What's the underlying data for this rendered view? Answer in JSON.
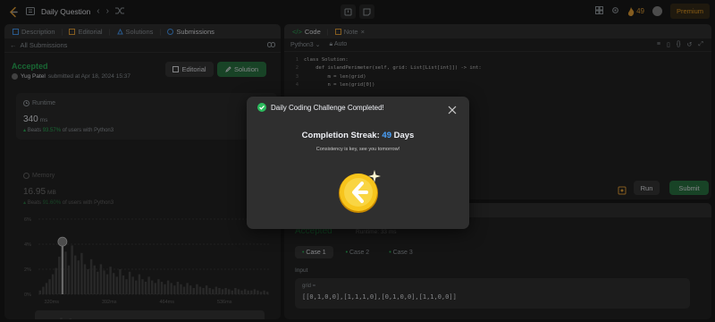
{
  "topbar": {
    "title": "Daily Question",
    "fire_count": "49",
    "premium_label": "Premium"
  },
  "left": {
    "tabs": [
      {
        "label": "Description",
        "active": false
      },
      {
        "label": "Editorial",
        "active": false
      },
      {
        "label": "Solutions",
        "active": false
      },
      {
        "label": "Submissions",
        "active": true
      }
    ],
    "back_label": "All Submissions",
    "status": "Accepted",
    "user": "Yug Patel",
    "submitted_text": "submitted at Apr 18, 2024 15:37",
    "editorial_btn": "Editorial",
    "solution_btn": "Solution",
    "runtime": {
      "label": "Runtime",
      "value": "340",
      "unit": "ms",
      "beats_prefix": "Beats",
      "beats_pct": "93.57%",
      "beats_suffix": "of users with Python3"
    },
    "memory": {
      "label": "Memory",
      "value": "16.95",
      "unit": "MB",
      "beats_prefix": "Beats",
      "beats_pct": "91.60%",
      "beats_suffix": "of users with Python3"
    }
  },
  "chart_data": {
    "type": "bar",
    "y_ticks": [
      "6%",
      "4%",
      "2%",
      "0%"
    ],
    "x_ticks": [
      "320ms",
      "392ms",
      "464ms",
      "536ms"
    ],
    "ylim": [
      0,
      6
    ],
    "values": [
      0.3,
      0.6,
      0.9,
      1.2,
      1.6,
      2.1,
      3.0,
      4.2,
      3.4,
      2.3,
      3.9,
      3.1,
      2.7,
      3.3,
      2.4,
      2.0,
      2.8,
      2.3,
      1.8,
      2.4,
      1.9,
      1.6,
      2.2,
      1.7,
      1.4,
      2.0,
      1.5,
      1.2,
      1.8,
      1.4,
      1.1,
      1.6,
      1.2,
      1.0,
      1.4,
      1.1,
      0.9,
      1.2,
      1.0,
      0.8,
      1.1,
      0.9,
      0.7,
      1.0,
      0.8,
      0.6,
      0.9,
      0.7,
      0.5,
      0.8,
      0.6,
      0.5,
      0.7,
      0.5,
      0.4,
      0.6,
      0.5,
      0.4,
      0.5,
      0.4,
      0.3,
      0.5,
      0.4,
      0.3,
      0.4,
      0.3,
      0.3,
      0.4,
      0.3,
      0.2,
      0.3,
      0.2
    ],
    "highlight_index": 7,
    "range_ticks": [
      "320ms",
      "392ms",
      "464ms",
      "536ms"
    ]
  },
  "code": {
    "tab_code": "Code",
    "tab_note": "Note",
    "language": "Python3",
    "auto": "Auto",
    "lines": [
      {
        "n": "1",
        "text": "class Solution:"
      },
      {
        "n": "2",
        "text": "    def islandPerimeter(self, grid: List[List[int]]) -> int:"
      },
      {
        "n": "3",
        "text": "        m = len(grid)"
      },
      {
        "n": "4",
        "text": "        n = len(grid[0])"
      }
    ],
    "run_label": "Run",
    "submit_label": "Submit"
  },
  "result": {
    "status": "Accepted",
    "runtime": "Runtime: 33 ms",
    "cases": [
      "Case 1",
      "Case 2",
      "Case 3"
    ],
    "input_label": "Input",
    "var_name": "grid =",
    "var_value": "[[0,1,0,0],[1,1,1,0],[0,1,0,0],[1,1,0,0]]"
  },
  "modal": {
    "title": "Daily Coding Challenge Completed!",
    "streak_prefix": "Completion Streak:",
    "streak_num": "49",
    "streak_suffix": "Days",
    "subtitle": "Consistency is key, see you tomorrow!"
  }
}
